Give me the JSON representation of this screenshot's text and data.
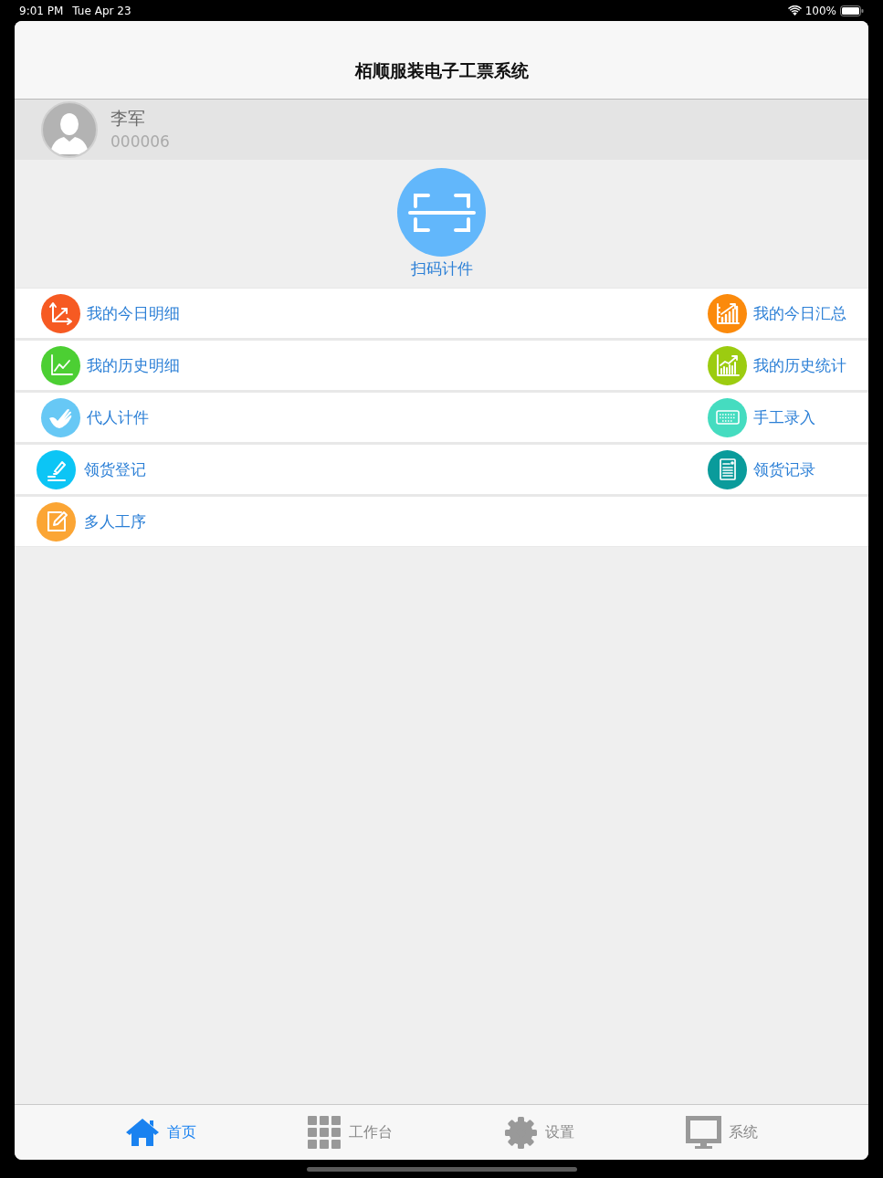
{
  "status_bar": {
    "time": "9:01 PM",
    "date": "Tue Apr 23",
    "battery": "100%"
  },
  "nav_bar": {
    "title": "栢顺服装电子工票系统"
  },
  "user": {
    "name": "李军",
    "id": "000006"
  },
  "scan_button": {
    "label": "扫码计件"
  },
  "menu_rows": [
    {
      "left": {
        "label": "我的今日明细",
        "color": "#f65a22"
      },
      "right": {
        "label": "我的今日汇总",
        "color": "#fb8a0c"
      }
    },
    {
      "left": {
        "label": "我的历史明细",
        "color": "#4ccf33"
      },
      "right": {
        "label": "我的历史统计",
        "color": "#9ccc10"
      }
    },
    {
      "left": {
        "label": "代人计件",
        "color": "#67c8f5"
      },
      "right": {
        "label": "手工录入",
        "color": "#45dcc0"
      }
    },
    {
      "left": {
        "label": "领货登记",
        "color": "#0cc5f5"
      },
      "right": {
        "label": "领货记录",
        "color": "#0a9b9b"
      }
    },
    {
      "left": {
        "label": "多人工序",
        "color": "#fba534"
      }
    }
  ],
  "tab_bar": [
    {
      "label": "首页",
      "selected": true
    },
    {
      "label": "工作台",
      "selected": false
    },
    {
      "label": "设置",
      "selected": false
    },
    {
      "label": "系统",
      "selected": false
    }
  ]
}
